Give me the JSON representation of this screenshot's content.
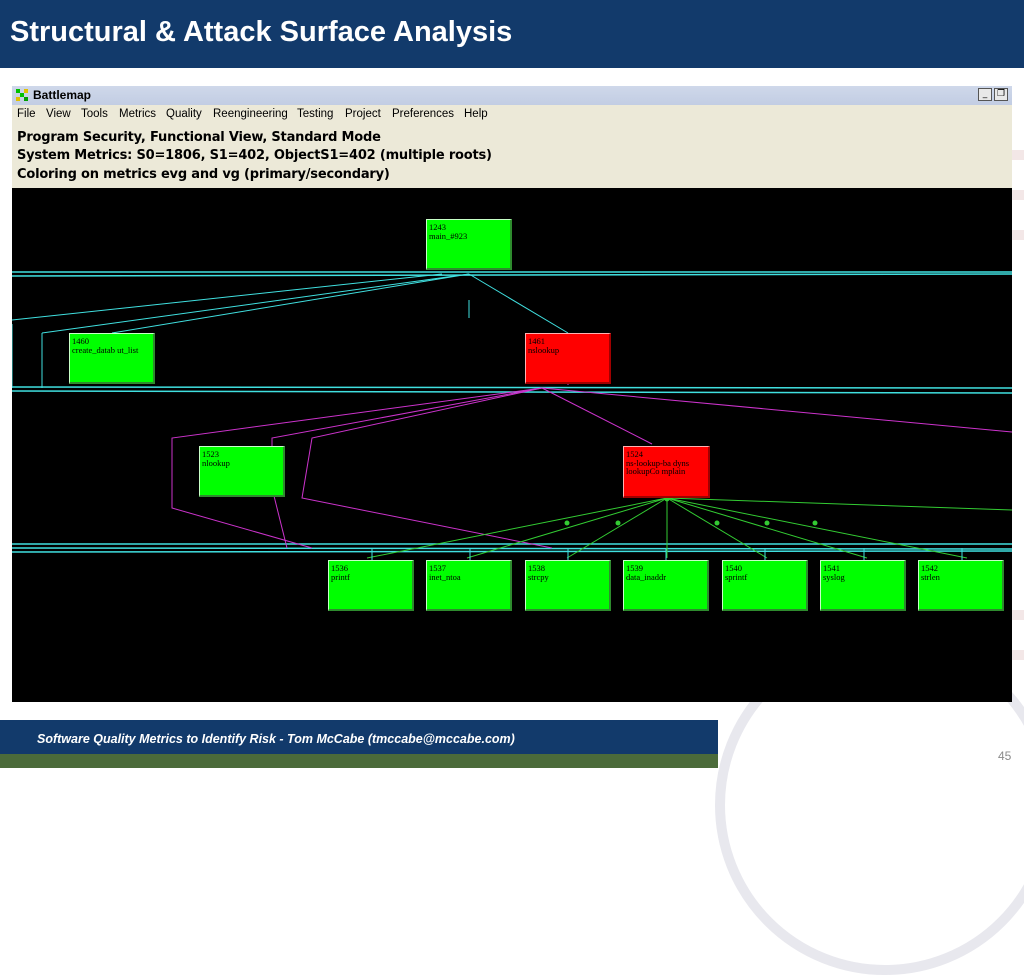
{
  "slide": {
    "title": "Structural & Attack Surface Analysis",
    "footer": "Software Quality Metrics to Identify Risk - Tom McCabe (tmccabe@mccabe.com)",
    "page_number": "45",
    "colors": {
      "header": "#123a6b",
      "footer_strip": "#4b6b3a"
    }
  },
  "window": {
    "title": "Battlemap",
    "controls": {
      "minimize": "_",
      "restore": "❐"
    }
  },
  "menu": [
    "File",
    "View",
    "Tools",
    "Metrics",
    "Quality",
    "Reengineering",
    "Testing",
    "Project",
    "Preferences",
    "Help"
  ],
  "info": {
    "line1": "Program Security,   Functional View, Standard Mode",
    "line2": "System Metrics: S0=1806, S1=402, ObjectS1=402 (multiple roots)",
    "line3": "Coloring on metrics evg and vg (primary/secondary)"
  },
  "nodes": [
    {
      "id": "1243",
      "label": "main_#923",
      "color": "green"
    },
    {
      "id": "1460",
      "label": "create_datab ut_list",
      "color": "green"
    },
    {
      "id": "1461",
      "label": "nslookup",
      "color": "red"
    },
    {
      "id": "1523",
      "label": "nlookup",
      "color": "green"
    },
    {
      "id": "1524",
      "label": "ns-lookup-ba dyns lookupCo mplain",
      "color": "red"
    },
    {
      "id": "1536",
      "label": "printf",
      "color": "green"
    },
    {
      "id": "1537",
      "label": "inet_ntoa",
      "color": "green"
    },
    {
      "id": "1538",
      "label": "strcpy",
      "color": "green"
    },
    {
      "id": "1539",
      "label": "data_inaddr",
      "color": "green"
    },
    {
      "id": "1540",
      "label": "sprintf",
      "color": "green"
    },
    {
      "id": "1541",
      "label": "syslog",
      "color": "green"
    },
    {
      "id": "1542",
      "label": "strlen",
      "color": "green"
    }
  ],
  "colors": {
    "node_green": "#00ff00",
    "node_red": "#ff0000",
    "edge_cyan": "#40e0e0",
    "edge_magenta": "#cc33cc",
    "edge_green": "#33cc33"
  }
}
